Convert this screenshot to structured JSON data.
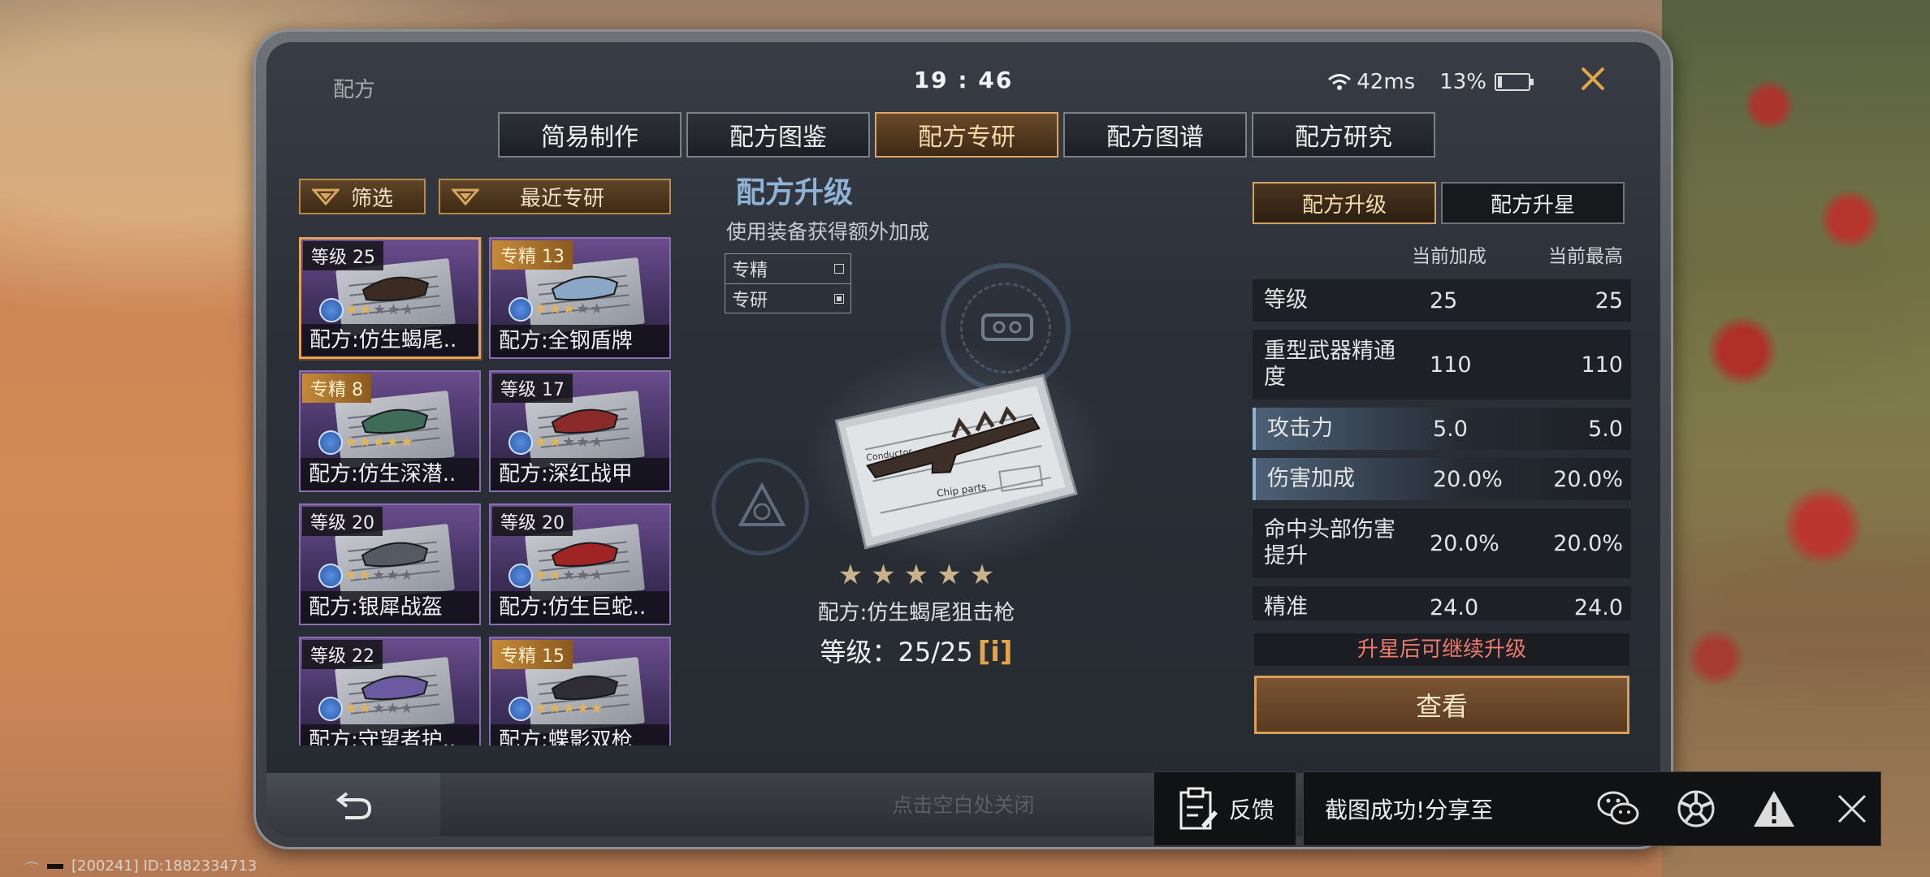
{
  "status": {
    "title": "配方",
    "time": "19 : 46",
    "ping": "42ms",
    "battery": "13%",
    "battery_level": 0.13
  },
  "tabs": [
    {
      "label": "简易制作",
      "active": false
    },
    {
      "label": "配方图鉴",
      "active": false
    },
    {
      "label": "配方专研",
      "active": true
    },
    {
      "label": "配方图谱",
      "active": false
    },
    {
      "label": "配方研究",
      "active": false
    }
  ],
  "left": {
    "filter_label": "筛选",
    "recent_label": "最近专研",
    "cards": [
      {
        "badge": "等级 25",
        "badge_type": "level",
        "name": "配方:仿生蝎尾..",
        "stars": 2,
        "selected": true,
        "item_color": "#3b2b22"
      },
      {
        "badge": "专精 13",
        "badge_type": "jing",
        "name": "配方:全钢盾牌",
        "stars": 3,
        "selected": false,
        "item_color": "#8aa7c8"
      },
      {
        "badge": "专精 8",
        "badge_type": "jing",
        "name": "配方:仿生深潜..",
        "stars": 5,
        "selected": false,
        "item_color": "#3e6b5a"
      },
      {
        "badge": "等级 17",
        "badge_type": "level",
        "name": "配方:深红战甲",
        "stars": 2,
        "selected": false,
        "item_color": "#8a2a2a"
      },
      {
        "badge": "等级 20",
        "badge_type": "level",
        "name": "配方:银犀战盔",
        "stars": 2,
        "selected": false,
        "item_color": "#555a62"
      },
      {
        "badge": "等级 20",
        "badge_type": "level",
        "name": "配方:仿生巨蛇..",
        "stars": 2,
        "selected": false,
        "item_color": "#a02424"
      },
      {
        "badge": "等级 22",
        "badge_type": "level",
        "name": "配方:守望者护..",
        "stars": 2,
        "selected": false,
        "item_color": "#6a5aa0"
      },
      {
        "badge": "专精 15",
        "badge_type": "jing",
        "name": "配方:蝶影双枪",
        "stars": 5,
        "selected": false,
        "item_color": "#2e2e34"
      }
    ]
  },
  "center": {
    "title": "配方升级",
    "subtitle": "使用装备获得额外加成",
    "legend": [
      {
        "label": "专精",
        "filled": false
      },
      {
        "label": "专研",
        "filled": true
      }
    ],
    "stars_total": 5,
    "stars_on": 5,
    "item_name": "配方:仿生蝎尾狙击枪",
    "level_label": "等级：",
    "level_value": "25/25",
    "info_glyph": "i"
  },
  "right": {
    "tab_upgrade": "配方升级",
    "tab_star": "配方升星",
    "col_current": "当前加成",
    "col_max": "当前最高",
    "stats": [
      {
        "label": "等级",
        "current": "25",
        "max": "25",
        "highlight": false,
        "tall": false
      },
      {
        "label": "重型武器精通度",
        "current": "110",
        "max": "110",
        "highlight": false,
        "tall": true
      },
      {
        "label": "攻击力",
        "current": "5.0",
        "max": "5.0",
        "highlight": true,
        "tall": false
      },
      {
        "label": "伤害加成",
        "current": "20.0%",
        "max": "20.0%",
        "highlight": true,
        "tall": false
      },
      {
        "label": "命中头部伤害提升",
        "current": "20.0%",
        "max": "20.0%",
        "highlight": false,
        "tall": true
      },
      {
        "label": "精准",
        "current": "24.0",
        "max": "24.0",
        "highlight": false,
        "tall": false
      }
    ],
    "notice": "升星后可继续升级",
    "view_label": "查看"
  },
  "bottom": {
    "close_hint": "点击空白处关闭"
  },
  "overlay": {
    "feedback_label": "反馈",
    "share_text": "截图成功!分享至",
    "icons": [
      "wechat-icon",
      "moments-icon",
      "warning-icon",
      "close-icon"
    ]
  },
  "footer": {
    "id_text": "[200241] ID:1882334713"
  },
  "colors": {
    "accent_gold": "#d9a666",
    "title_blue": "#8fb3d6",
    "notice_red": "#ee7a6a",
    "star_gold": "#e3b35a"
  }
}
